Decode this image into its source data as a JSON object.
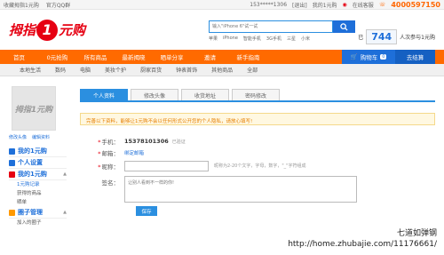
{
  "topbar": {
    "left_links": [
      "收藏拇指1元购",
      "官方QQ群"
    ],
    "phone": "153*****1306",
    "logout": "[退出]",
    "my_account": "我的1元购",
    "weibo": "",
    "service": "在线客服",
    "hotline": "4000597150"
  },
  "header": {
    "logo_prefix": "拇指",
    "logo_number": "1",
    "logo_suffix": "元购",
    "search_placeholder": "输入\"iPhone 6\"试一试",
    "search_icon": "search-icon",
    "hot_keywords": [
      "苹果",
      "iPhone",
      "智能手机",
      "3G手机",
      "三星",
      "小米"
    ],
    "counter_prefix": "已",
    "counter_value": "744",
    "counter_suffix": "人次参与1元购"
  },
  "nav": {
    "items": [
      "首页",
      "0元抢购",
      "所有商品",
      "最新揭晓",
      "晒单分享",
      "邀请",
      "新手指南"
    ],
    "cart_label": "购物车",
    "cart_count": "0",
    "settle_label": "去结算"
  },
  "subnav": {
    "items": [
      "本地生活",
      "数码",
      "电脑",
      "美妆个护",
      "厨家百货",
      "钟表首饰",
      "其他商品",
      "全部"
    ]
  },
  "sidebar": {
    "avatar_logo": "拇指1元购",
    "avatar_links": [
      "修改头像",
      "编辑资料"
    ],
    "sections": [
      {
        "title": "我的1元购",
        "subs": []
      },
      {
        "title": "个人设置",
        "subs": []
      },
      {
        "title": "我的1元购",
        "subs": [
          "1元购记录",
          "获得的商品",
          "晒单"
        ]
      },
      {
        "title": "圈子管理",
        "subs": [
          "加入的圈子"
        ]
      }
    ]
  },
  "main": {
    "tabs": [
      "个人资料",
      "修改头像",
      "收货地址",
      "密码修改"
    ],
    "notice": "完善以下资料，能够让1元购不会以任何形式公开您的个人隐私，请放心填写!",
    "form": {
      "phone_label": "手机：",
      "phone_value": "15378101306",
      "phone_status": "已验证",
      "email_label": "邮箱：",
      "email_link": "绑定邮箱",
      "nick_label": "昵称：",
      "nick_value": "",
      "nick_hint": "昵称为2-20个文字，字母，数字，\"_\"字符组成",
      "sig_label": "签名：",
      "sig_placeholder": "让别人看到不一样的你!",
      "save_label": "保存"
    }
  },
  "watermark": {
    "line1": "七道如弹钢",
    "line2": "http://home.zhubajie.com/11176661/"
  }
}
